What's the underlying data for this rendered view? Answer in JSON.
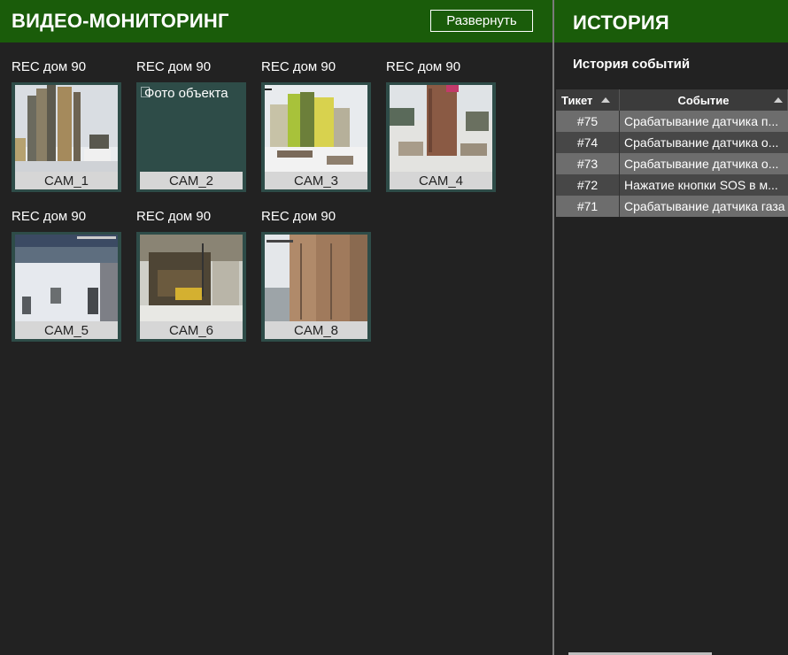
{
  "video": {
    "title": "ВИДЕО-МОНИТОРИНГ",
    "expand_label": "Развернуть",
    "cameras_row1": [
      {
        "label": "REC дом 90",
        "name": "CAM_1"
      },
      {
        "label": "REC дом 90",
        "name": "CAM_2",
        "broken_alt": "Фото объекта"
      },
      {
        "label": "REC дом 90",
        "name": "CAM_3"
      },
      {
        "label": "REC дом 90",
        "name": "CAM_4"
      }
    ],
    "cameras_row2": [
      {
        "label": "REC дом 90",
        "name": "CAM_5"
      },
      {
        "label": "REC дом 90",
        "name": "CAM_6"
      },
      {
        "label": "REC дом 90",
        "name": "CAM_8"
      }
    ]
  },
  "history": {
    "title": "ИСТОРИЯ",
    "subtitle": "История событий",
    "columns": {
      "ticket": "Тикет",
      "event": "Событие"
    },
    "rows": [
      {
        "ticket": "#75",
        "event": "Срабатывание датчика п..."
      },
      {
        "ticket": "#74",
        "event": "Срабатывание датчика о..."
      },
      {
        "ticket": "#73",
        "event": "Срабатывание датчика о..."
      },
      {
        "ticket": "#72",
        "event": "Нажатие кнопки SOS в м..."
      },
      {
        "ticket": "#71",
        "event": "Срабатывание датчика газа"
      }
    ]
  },
  "colors": {
    "header_bg": "#1a5c0a",
    "page_bg": "#222222",
    "tile_frame": "#2e4c48",
    "row_light": "#6d6d6d",
    "row_dark": "#474747"
  }
}
